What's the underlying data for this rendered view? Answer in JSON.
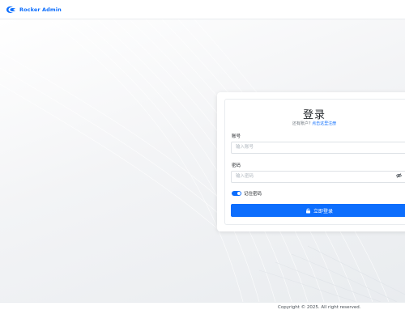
{
  "header": {
    "brand": "Rocker Admin",
    "logo_icon": "rocker-logo-icon"
  },
  "login": {
    "title": "登录",
    "subtitle_prefix": "还有账户?",
    "subtitle_link": "点击这里注册",
    "account_label": "账号",
    "account_placeholder": "输入账号",
    "password_label": "密码",
    "password_placeholder": "输入密码",
    "password_toggle_icon": "eye-icon",
    "remember_label": "记住密码",
    "remember_checked": true,
    "submit_label": "立即登录",
    "submit_icon": "lock-icon"
  },
  "footer": {
    "copyright": "Copyright © 2025. All right reserved."
  },
  "colors": {
    "primary": "#0d6efd",
    "background": "#f3f4f6",
    "card": "#ffffff"
  }
}
